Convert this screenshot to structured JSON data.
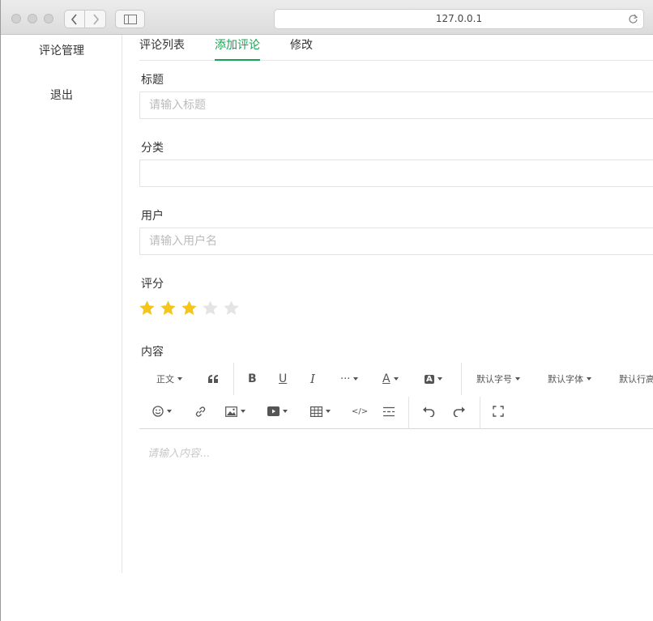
{
  "browser": {
    "url": "127.0.0.1"
  },
  "sidebar": {
    "items": [
      {
        "label": "评论管理"
      },
      {
        "label": "退出"
      }
    ]
  },
  "tabs": [
    {
      "label": "评论列表"
    },
    {
      "label": "添加评论"
    },
    {
      "label": "修改"
    }
  ],
  "form": {
    "title": {
      "label": "标题",
      "placeholder": "请输入标题",
      "value": ""
    },
    "category": {
      "label": "分类",
      "value": ""
    },
    "user": {
      "label": "用户",
      "placeholder": "请输入用户名",
      "value": ""
    },
    "rating": {
      "label": "评分",
      "value": 3,
      "max": 5,
      "color": "#f5c518"
    },
    "content": {
      "label": "内容",
      "placeholder": "请输入内容..."
    }
  },
  "editor_toolbar": {
    "paragraph": "正文",
    "font_size": "默认字号",
    "font_family": "默认字体",
    "line_height": "默认行高"
  },
  "colors": {
    "accent": "#16a351"
  }
}
